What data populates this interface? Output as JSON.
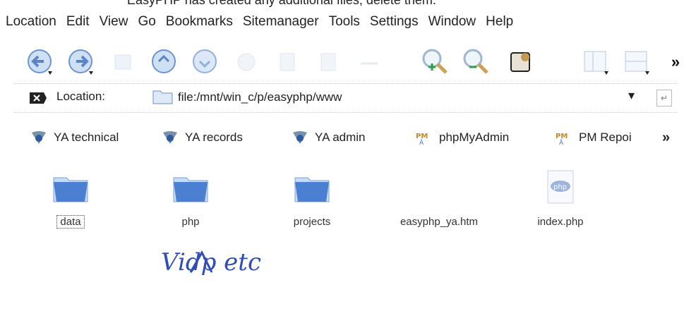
{
  "top_note": "EasyPHP has created any additional files, delete them.",
  "menubar": {
    "items": [
      {
        "label": "Location"
      },
      {
        "label": "Edit"
      },
      {
        "label": "View"
      },
      {
        "label": "Go"
      },
      {
        "label": "Bookmarks"
      },
      {
        "label": "Sitemanager"
      },
      {
        "label": "Tools"
      },
      {
        "label": "Settings"
      },
      {
        "label": "Window"
      },
      {
        "label": "Help"
      }
    ]
  },
  "toolbar": {
    "icons": [
      "back-icon",
      "forward-icon",
      "home-icon",
      "reload-icon",
      "stop-icon",
      "print-icon",
      "zoom-in-icon",
      "zoom-out-icon",
      "find-icon",
      "view-icon",
      "view-split-icon",
      "more-icon"
    ],
    "more_label": "»"
  },
  "location": {
    "label": "Location:",
    "url": "file:/mnt/win_c/p/easyphp/www"
  },
  "bookmarks": {
    "items": [
      {
        "label": "YA technical"
      },
      {
        "label": "YA records"
      },
      {
        "label": "YA admin"
      },
      {
        "label": "phpMyAdmin"
      },
      {
        "label": "PM Repoi"
      }
    ],
    "more_label": "»"
  },
  "files": [
    {
      "name": "data",
      "type": "folder"
    },
    {
      "name": "php",
      "type": "folder"
    },
    {
      "name": "projects",
      "type": "folder"
    },
    {
      "name": "easyphp_ya.htm",
      "type": "file"
    },
    {
      "name": "index.php",
      "type": "file"
    }
  ],
  "annotation": {
    "handwritten": "Vidp etc"
  },
  "colors": {
    "folder": "#4a7fd1",
    "annotation": "#2f4db5"
  }
}
